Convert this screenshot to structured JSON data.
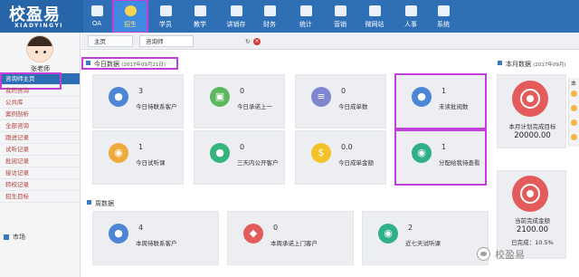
{
  "app": {
    "logo_main": "校盈易",
    "logo_sub": "XIADYINGYI"
  },
  "nav": {
    "items": [
      {
        "label": "OA",
        "icon": "oa-icon"
      },
      {
        "label": "招生",
        "icon": "enroll-icon"
      },
      {
        "label": "学员",
        "icon": "student-icon"
      },
      {
        "label": "教学",
        "icon": "teaching-icon"
      },
      {
        "label": "讲销存",
        "icon": "inventory-icon"
      },
      {
        "label": "财务",
        "icon": "finance-icon"
      },
      {
        "label": "统计",
        "icon": "stats-icon"
      },
      {
        "label": "营销",
        "icon": "marketing-icon"
      },
      {
        "label": "微网站",
        "icon": "microsite-icon"
      },
      {
        "label": "人事",
        "icon": "hr-icon"
      },
      {
        "label": "系统",
        "icon": "system-icon"
      }
    ],
    "active_index": 1
  },
  "user": {
    "name": "张老师"
  },
  "sidebar": {
    "items": [
      {
        "label": "咨询师主页"
      },
      {
        "label": "我的咨询"
      },
      {
        "label": "公共库"
      },
      {
        "label": "案例剖析"
      },
      {
        "label": "全部咨询"
      },
      {
        "label": "跟进记录"
      },
      {
        "label": "试听记录"
      },
      {
        "label": "批阅记录"
      },
      {
        "label": "接访记录"
      },
      {
        "label": "转校记录"
      },
      {
        "label": "招生目标"
      }
    ],
    "active_index": 0,
    "market_label": "市场"
  },
  "tabs": {
    "items": [
      {
        "label": "主页"
      },
      {
        "label": "咨询师"
      }
    ],
    "refresh_glyph": "↻",
    "close_glyph": "×"
  },
  "today": {
    "title": "今日数据",
    "date": "(2017年09月21日)",
    "cards": [
      {
        "value": "3",
        "label": "今日待联系客户",
        "color": "#4e86d6",
        "icon": "person-icon",
        "glyph": "●"
      },
      {
        "value": "0",
        "label": "今日承诺上一",
        "color": "#5cb85c",
        "icon": "calendar-icon",
        "glyph": "▣"
      },
      {
        "value": "0",
        "label": "今日成单数",
        "color": "#7f86cf",
        "icon": "list-icon",
        "glyph": "≡"
      },
      {
        "value": "1",
        "label": "未读批阅数",
        "color": "#4e86d6",
        "icon": "user-card-icon",
        "glyph": "●"
      },
      {
        "value": "1",
        "label": "今日试听课",
        "color": "#f0a93c",
        "icon": "headset-icon",
        "glyph": "◉"
      },
      {
        "value": "0",
        "label": "三天内公开客户",
        "color": "#37b37e",
        "icon": "group-icon",
        "glyph": "●"
      },
      {
        "value": "0.0",
        "label": "今日成单金额",
        "color": "#f3c12a",
        "icon": "coins-icon",
        "glyph": "$"
      },
      {
        "value": "1",
        "label": "分配给我待查看",
        "color": "#2fb08a",
        "icon": "headset-icon",
        "glyph": "◉"
      }
    ]
  },
  "week": {
    "title": "周数据",
    "cards": [
      {
        "value": "4",
        "label": "本周待联系客户",
        "color": "#4e86d6",
        "icon": "person-icon",
        "glyph": "●"
      },
      {
        "value": "0",
        "label": "本周承诺上门客户",
        "color": "#e45b5b",
        "icon": "location-icon",
        "glyph": "◆"
      },
      {
        "value": "2",
        "label": "近七天试听课",
        "color": "#2fb08a",
        "icon": "headset-icon",
        "glyph": "◉"
      }
    ]
  },
  "month": {
    "title": "本月数据",
    "date": "(2017年09月)",
    "target_label": "本月计划完成目标",
    "target_value": "20000.00",
    "current_label": "当前完成金额",
    "current_value": "2100.00",
    "rate_label": "已完成：10.5%",
    "side_title": "本"
  },
  "watermark": {
    "text": "校盈易"
  },
  "colors": {
    "nav_bg": "#2e6fb5",
    "accent": "#2d6db4",
    "highlight": "#c03fd8",
    "target": "#e45b5b"
  }
}
